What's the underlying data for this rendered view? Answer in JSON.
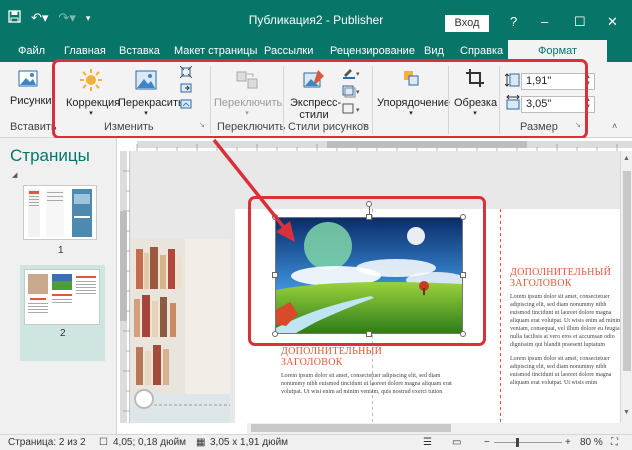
{
  "titlebar": {
    "title": "Публикация2 - Publisher",
    "login_label": "Вход",
    "help": "?",
    "min": "–",
    "max": "☐",
    "close": "✕"
  },
  "tabs": [
    {
      "label": "Файл"
    },
    {
      "label": "Главная"
    },
    {
      "label": "Вставка"
    },
    {
      "label": "Макет страницы"
    },
    {
      "label": "Рассылки"
    },
    {
      "label": "Рецензирование"
    },
    {
      "label": "Вид"
    },
    {
      "label": "Справка"
    },
    {
      "label": "Формат"
    }
  ],
  "ribbon": {
    "insert_group": {
      "picture_label": "Рисунки",
      "group_label": "Вставить"
    },
    "adjust_group": {
      "correction_label": "Коррекция",
      "recolor_label": "Перекрасить",
      "group_label": "Изменить"
    },
    "swap_group": {
      "swap_label": "Переключить",
      "group_label": "Переключить"
    },
    "styles_group": {
      "express_label_1": "Экспресс-",
      "express_label_2": "стили",
      "group_label": "Стили рисунков"
    },
    "arrange_group": {
      "order_label": "Упорядочение"
    },
    "crop_group": {
      "crop_label": "Обрезка"
    },
    "size_group": {
      "height_value": "1,91\"",
      "width_value": "3,05\"",
      "group_label": "Размер"
    }
  },
  "pages_panel": {
    "title": "Страницы",
    "thumb1_number": "1",
    "thumb2_number": "2"
  },
  "document": {
    "heading_main_1": "ДОПОЛНИТЕЛЬНЫЙ",
    "heading_main_2": "ЗАГОЛОВОК",
    "lorem_main": "Lorem ipsum dolor sit amet, consectetuer adipiscing elit, sed diam nonummy nibh euismod tincidunt ut laoreet dolore magna aliquam erat volutpat. Ut wisi enim ad minim veniam, quis nostrud exerci tution",
    "heading_side_1": "ДОПОЛНИТЕЛЬНЫЙ",
    "heading_side_2": "ЗАГОЛОВОК",
    "lorem_side_1": "Lorem ipsum dolor sit amet, consectetuer adipiscing elit, sed diam nonummy nibh euismod tincidunt ut laoreet dolore magna aliquam erat volutpat. Ut wisis enim ad minim veniam, consequat, vel illum dolore eu feugiat nulla facilisis at vero eros et accumsan odio dignissim qui blandit praesent luptatum",
    "lorem_side_2": "Lorem ipsum dolor sit amet, consectetuer adipiscing elit, sed diam nonummy nibh euismod tincidunt ut laoreet dolore magna aliquam erat volutpat. Ut wisis enim"
  },
  "status": {
    "page": "Страница: 2 из 2",
    "position": "4,05; 0,18 дюйм",
    "size": "3,05 x 1,91 дюйм",
    "zoom": "80 %"
  },
  "colors": {
    "accent": "#077568",
    "highlight": "#d9303a",
    "heading": "#e2573b"
  },
  "icons": [
    "save-icon",
    "undo-icon",
    "redo-icon",
    "customize-qat-icon",
    "picture-icon",
    "correction-icon",
    "recolor-icon",
    "compress-icon",
    "swap-icon",
    "express-styles-icon",
    "border-icon",
    "effects-icon",
    "arrange-icon",
    "crop-icon",
    "height-icon",
    "width-icon"
  ]
}
